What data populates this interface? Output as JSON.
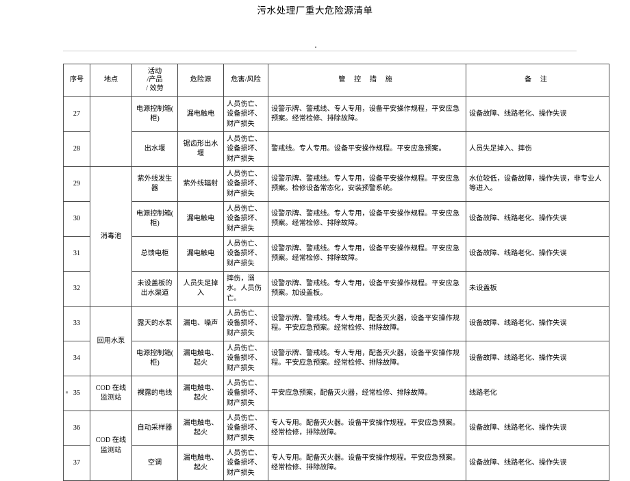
{
  "document": {
    "title": "污水处理厂重大危险源清单"
  },
  "table": {
    "headers": {
      "no": "序号",
      "location": "地点",
      "activity_line1": "活动",
      "activity_line2": "/产品",
      "activity_line3": "/ 效劳",
      "source": "危险源",
      "risk": "危害/风险",
      "measures": "管 控 措 施",
      "remarks": "备    注"
    },
    "rows": [
      {
        "no": "27",
        "location": "",
        "activity": "电源控制箱( 柜)",
        "source": "漏电触电",
        "risk": "人员伤亡、设备损坏、财产损失",
        "measures": "设警示牌、警戒线、专人专用，设备平安操作规程，平安应急预案。经常检修、排除故障。",
        "remarks": "设备故障、线路老化、操作失误"
      },
      {
        "no": "28",
        "location": "",
        "activity": "出水堰",
        "source": "锯齿形出水堰",
        "risk": "人员伤亡、设备损坏、财产损失",
        "measures": "警戒线。专人专用。设备平安操作规程。平安应急预案。",
        "remarks": "人员失足掉入、摔伤"
      },
      {
        "no": "29",
        "location": "",
        "activity": "紫外线发生器",
        "source": "紫外线辐射",
        "risk": "人员伤亡、设备损坏、财产损失",
        "measures": "设警示牌、警戒线。专人专用，设备平安操作规程。平安应急预案。检修设备常态化，安装预警系统。",
        "remarks": "水位较低，设备故障，操作失误，非专业人等进入。"
      },
      {
        "no": "30",
        "location": "消毒池",
        "activity": "电源控制箱( 柜)",
        "source": "漏电触电",
        "risk": "人员伤亡、设备损坏、财产损失",
        "measures": "设警示牌、警戒线。专人专用，设备平安操作规程。平安应急预案。经常检修、排除故障。",
        "remarks": "设备故障、线路老化、操作失误"
      },
      {
        "no": "31",
        "location": "",
        "activity": "总馈电柜",
        "source": "漏电触电",
        "risk": "人员伤亡、设备损坏、财产损失",
        "measures": "设警示牌、警戒线。专人专用，设备平安操作规程。平安应急预案。经常检修、排除故障。",
        "remarks": "设备故障、线路老化、操作失误"
      },
      {
        "no": "32",
        "location": "",
        "activity": "未设盖板的出水渠道",
        "source": "人员失足掉入",
        "risk": "摔伤，溺水。人员伤亡。",
        "measures": "设警示牌、警戒线。专人专用，设备平安操作规程。平安应急预案。加设盖板。",
        "remarks": "未设盖板"
      },
      {
        "no": "33",
        "location": "回用水泵",
        "activity": "露天的水泵",
        "source": "漏电、噪声",
        "risk": "人员伤亡、设备损坏、财产损失",
        "measures": "设警示牌、警戒线。专人专用，配备灭火器，设备平安操作规程。平安应急预案。经常检修、排除故障。",
        "remarks": "设备故障、线路老化、操作失误"
      },
      {
        "no": "34",
        "location": "",
        "activity": "电源控制箱( 柜)",
        "source": "漏电触电、起火",
        "risk": "人员伤亡、设备损坏、财产损失",
        "measures": "设警示牌、警戒线。专人专用，配备灭火器，设备平安操作规程。平安应急预案。经常检修、排除故障。",
        "remarks": "设备故障、线路老化、操作失误"
      },
      {
        "no": "35",
        "location": "COD 在线监测站",
        "activity": "裸露的电线",
        "source": "漏电触电、起火",
        "risk": "人员伤亡、设备损坏、财产损失",
        "measures": "平安应急预案，配备灭火器，经常检修、排除故障。",
        "remarks": "线路老化"
      },
      {
        "no": "36",
        "location": "COD 在线监测站",
        "activity": "自动采样器",
        "source": "漏电触电、起火",
        "risk": "人员伤亡、设备损坏、财产损失",
        "measures": "专人专用。配备灭火器。设备平安操作规程。平安应急预案。经常检修，排除故障。",
        "remarks": "设备故障、线路老化、操作失误"
      },
      {
        "no": "37",
        "location": "",
        "activity": "空调",
        "source": "漏电触电、起火",
        "risk": "人员伤亡、设备损坏、财产损失",
        "measures": "专人专用。配备灭火器。设备平安操作规程。平安应急预案。经常检修、排除故障。",
        "remarks": "设备故障、线路老化、操作失误"
      }
    ]
  }
}
